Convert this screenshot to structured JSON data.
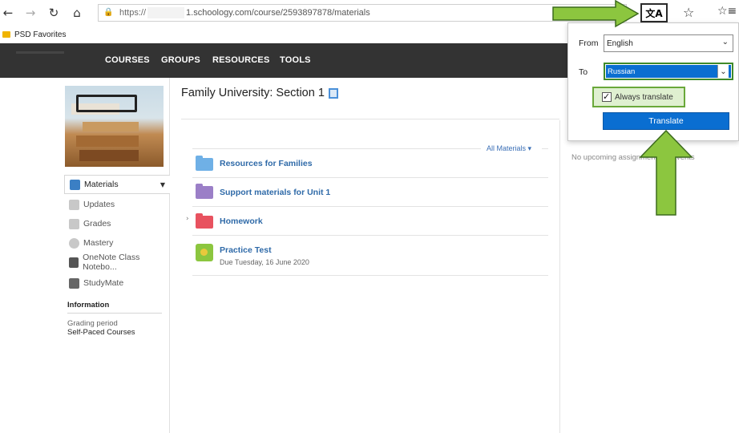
{
  "browser": {
    "url_prefix": "https://",
    "url_rest": "1.schoology.com/course/2593897878/materials",
    "favorites_label": "PSD Favorites"
  },
  "topnav": {
    "items": [
      "COURSES",
      "GROUPS",
      "RESOURCES",
      "TOOLS"
    ]
  },
  "sidebar": {
    "items": [
      {
        "label": "Materials"
      },
      {
        "label": "Updates"
      },
      {
        "label": "Grades"
      },
      {
        "label": "Mastery"
      },
      {
        "label": "OneNote Class Notebo..."
      },
      {
        "label": "StudyMate"
      }
    ],
    "information_heading": "Information",
    "grading_period_label": "Grading period",
    "grading_period_value": "Self-Paced Courses"
  },
  "main": {
    "course_title": "Family University: Section 1",
    "filter_label": "All Materials",
    "materials": [
      {
        "name": "Resources for Families",
        "color": "#6fb0e6"
      },
      {
        "name": "Support materials for Unit 1",
        "color": "#9b7fc7"
      },
      {
        "name": "Homework",
        "color": "#e8525f"
      },
      {
        "name": "Practice Test",
        "due": "Due Tuesday, 16 June 2020"
      }
    ],
    "upcoming_text": "No upcoming assignments or events"
  },
  "translate_popup": {
    "from_label": "From",
    "from_value": "English",
    "to_label": "To",
    "to_value": "Russian",
    "always_translate_label": "Always translate",
    "always_translate_checked": true,
    "translate_button": "Translate"
  },
  "colors": {
    "accent_blue": "#0a6ed1",
    "nav_dark": "#333333",
    "annotation_green": "#8cc63f"
  }
}
